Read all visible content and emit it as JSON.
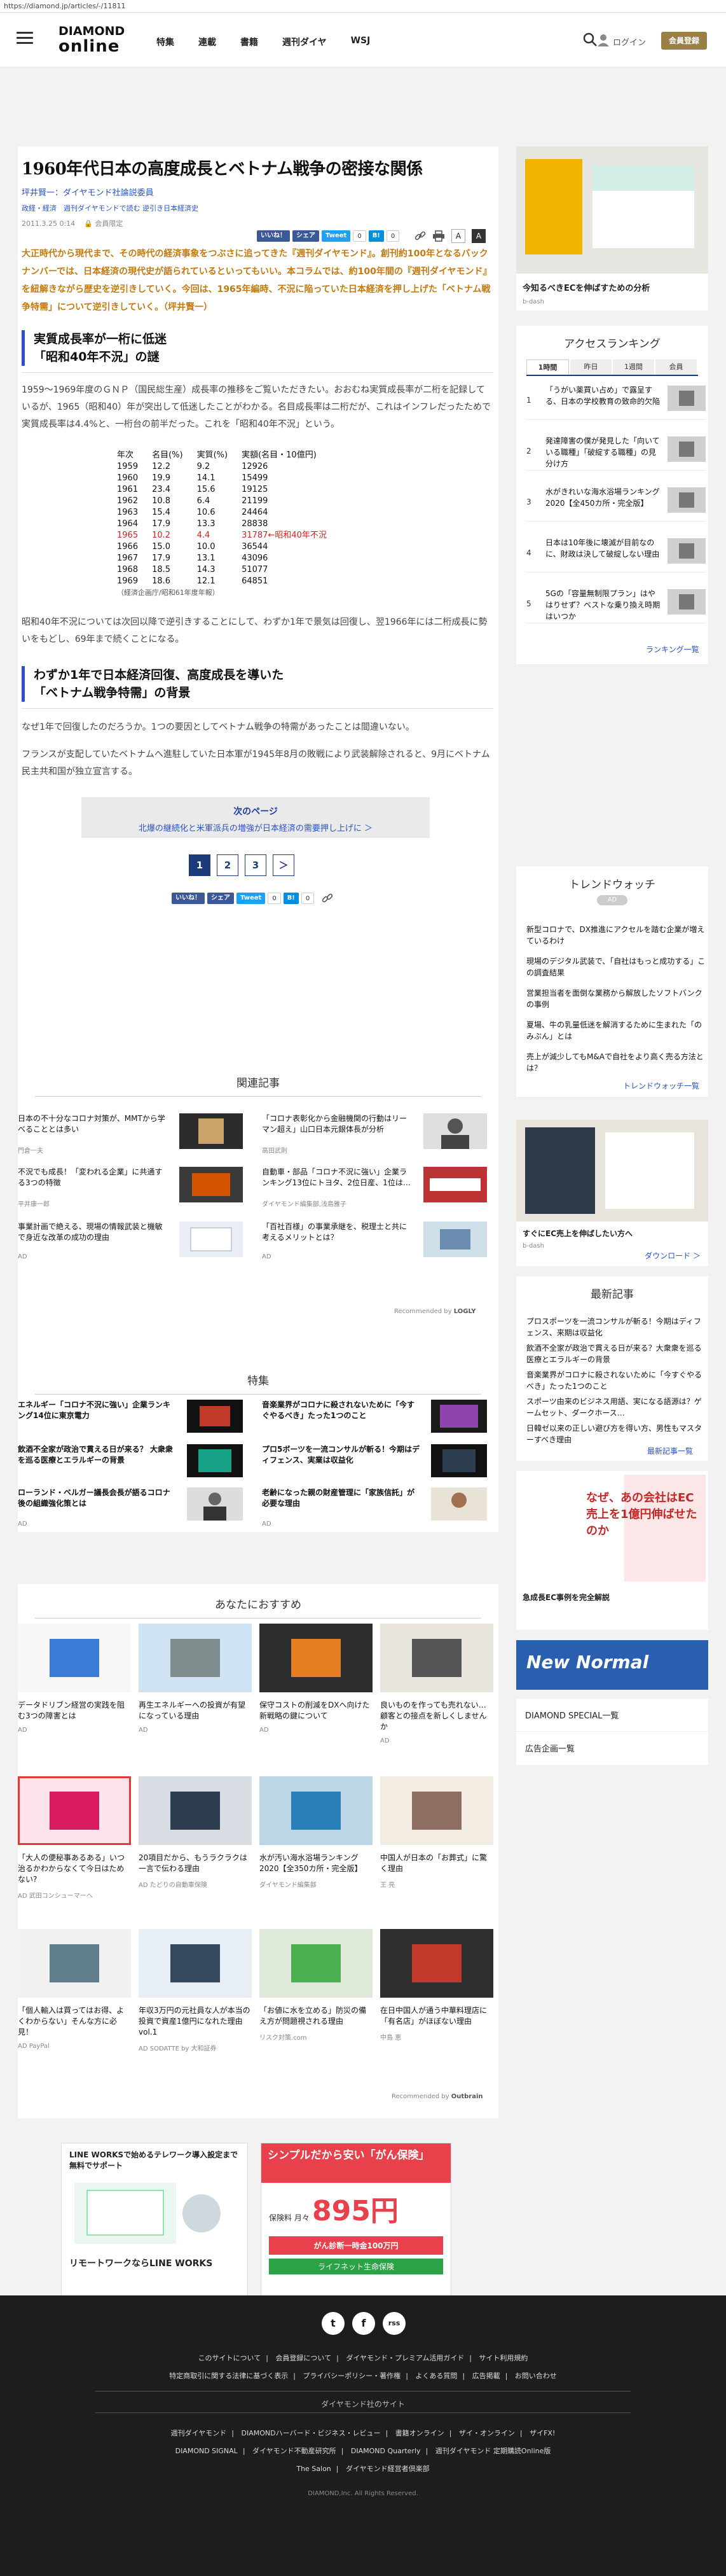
{
  "browser": {
    "url": "https://diamond.jp/articles/-/11811"
  },
  "header": {
    "logo_line1": "DIAMOND",
    "logo_line2": "online",
    "nav": [
      "特集",
      "連載",
      "書籍",
      "週刊ダイヤ",
      "WSJ"
    ],
    "login": "ログイン",
    "member": "会員登録"
  },
  "article": {
    "title": "1960年代日本の高度成長とベトナム戦争の密接な関係",
    "author": "坪井賢一：ダイヤモンド社論説委員",
    "categories": "政経・経済　週刊ダイヤモンドで読む 逆引き日本経済史",
    "date": "2011.3.25 0:14",
    "members_only": "会員限定",
    "share": {
      "fb": "いいね！",
      "fb_share": "シェア",
      "tw": "Tweet",
      "count1": "0",
      "hb": "B!",
      "count2": "0"
    },
    "font_small": "A",
    "font_large": "A",
    "lead": "大正時代から現代まで、その時代の経済事象をつぶさに追ってきた『週刊ダイヤモンド』。創刊約100年となるバックナンバーでは、日本経済の現代史が語られているといってもいい。本コラムでは、約100年間の『週刊ダイヤモンド』を紐解きながら歴史を逆引きしていく。今回は、1965年編時、不況に陥っていた日本経済を押し上げた「ベトナム戦争特需」について逆引きしていく。（坪井賢一）",
    "h2_1_line1": "実質成長率が一桁に低迷",
    "h2_1_line2": "「昭和40年不況」の謎",
    "p1": "1959～1969年度のＧＮＰ（国民総生産）成長率の推移をご覧いただきたい。おおむね実質成長率が二桁を記録しているが、1965（昭和40）年が突出して低迷したことがわかる。名目成長率は二桁だが、これはインフレだったためで実質成長率は4.4%と、一桁台の前半だった。これを「昭和40年不況」という。",
    "gdp_table": {
      "headers": [
        "年次",
        "名目(%)",
        "実質(%)",
        "実額(名目・10億円)"
      ],
      "rows": [
        [
          "1959",
          "12.2",
          "9.2",
          "12926",
          ""
        ],
        [
          "1960",
          "19.9",
          "14.1",
          "15499",
          ""
        ],
        [
          "1961",
          "23.4",
          "15.6",
          "19125",
          ""
        ],
        [
          "1962",
          "10.8",
          "6.4",
          "21199",
          ""
        ],
        [
          "1963",
          "15.4",
          "10.6",
          "24464",
          ""
        ],
        [
          "1964",
          "17.9",
          "13.3",
          "28838",
          ""
        ],
        [
          "1965",
          "10.2",
          "4.4",
          "31787",
          "←昭和40年不況"
        ],
        [
          "1966",
          "15.0",
          "10.0",
          "36544",
          ""
        ],
        [
          "1967",
          "17.9",
          "13.1",
          "43096",
          ""
        ],
        [
          "1968",
          "18.5",
          "14.3",
          "51077",
          ""
        ],
        [
          "1969",
          "18.6",
          "12.1",
          "64851",
          ""
        ]
      ],
      "note": "（経済企画庁/昭和61年度年報）"
    },
    "p2": "昭和40年不況については次回以降で逆引きすることにして、わずか1年で景気は回復し、翌1966年には二桁成長に勢いをもどし、69年まで続くことになる。",
    "h2_2_line1": "わずか1年で日本経済回復、高度成長を導いた",
    "h2_2_line2": "「ベトナム戦争特需」の背景",
    "p3": "なぜ1年で回復したのだろうか。1つの要因としてベトナム戦争の特需があったことは間違いない。",
    "p4": "フランスが支配していたベトナムへ進駐していた日本軍が1945年8月の敗戦により武装解除されると、9月にベトナム民主共和国が独立宣言する。",
    "next_label": "次のページ",
    "next_title": "北爆の継続化と米軍派兵の増強が日本経済の需要押し上げに ＞",
    "pages": [
      "1",
      "2",
      "3",
      "＞"
    ]
  },
  "related": {
    "title": "関連記事",
    "items": [
      {
        "text": "日本の不十分なコロナ対策が、MMTから学べることとは多い",
        "source": "門倉一夫"
      },
      {
        "text": "「コロナ表彰化から金融機関の行動はリーマン超え」山口日本元銀体長が分析",
        "source": "高田武則"
      },
      {
        "text": "不況でも成長！「変われる企業」に共通する3つの特徴",
        "source": "平井康一郎"
      },
      {
        "text": "自動車・部品「コロナ不況に強い」企業ランキング13位にトヨタ、2位日産、1位は…",
        "source": "ダイヤモンド編集部,浅島雅子"
      },
      {
        "text": "事業計画で絶える、現場の情報武装と機敏で身近な改革の成功の理由",
        "source": "AD"
      },
      {
        "text": "「百社百様」の事業承継を、税理士と共に考えるメリットとは？",
        "source": "AD"
      }
    ],
    "recommended": "Recommended by",
    "recommended_brand": "LOGLY"
  },
  "feature": {
    "title": "特集",
    "items": [
      {
        "text": "エネルギー「コロナ不況に強い」企業ランキング14位に東京電力",
        "source": ""
      },
      {
        "text": "音楽業界がコロナに殺されないために「今すぐやるべき」たった1つのこと",
        "source": ""
      },
      {
        "text": "飲酒不全家が政治で貫える日が来る？ 大衆衆を巡る医療とエラルギーの背景",
        "source": ""
      },
      {
        "text": "プロ5ボーツを一流コンサルが斬る！今期はディフェンス、実業は収益化",
        "source": ""
      },
      {
        "text": "ローランド・ベルガー議長会長が語るコロナ後の組織強化策とは",
        "source": "AD"
      },
      {
        "text": "老齢になった親の財産管理に「家族信託」が必要な理由",
        "source": "AD"
      }
    ]
  },
  "recommend": {
    "title": "あなたにおすすめ",
    "items": [
      {
        "text": "データドリブン経営の実践を阻む3つの障害とは",
        "source": "AD"
      },
      {
        "text": "再生エネルギーへの投資が有望になっている理由",
        "source": "AD"
      },
      {
        "text": "保守コストの削減をDXへ向けた新戦略の鍵について",
        "source": "AD"
      },
      {
        "text": "良いものを作っても売れない…顧客との接点を新しくしませんか",
        "source": "AD"
      },
      {
        "text": "「大人の便秘事あるある」いつ治るかわからなくて今日はためない?",
        "source": "AD 武田コンシューマーヘ"
      },
      {
        "text": "20項目だから、もうラクラクは一言で伝わる理由",
        "source": "AD たどりの自動車保険"
      },
      {
        "text": "水が汚い海水浴場ランキング2020【全350カ所・完全版】",
        "source": "ダイヤモンド編集部"
      },
      {
        "text": "中国人が日本の「お葬式」に驚く理由",
        "source": "王 亮"
      },
      {
        "text": "「個人輸入は買ってはお得、よくわからない」そんな方に必見！",
        "source": "AD PayPal"
      },
      {
        "text": "年収3万円の元社員な人が本当の投資で資産1億円になれた理由 vol.1",
        "source": "AD SODATTE by 大和証券"
      },
      {
        "text": "「お値に水を立める」防災の備え方が問題視される理由",
        "source": "リスク対策.com"
      },
      {
        "text": "在日中国人が通う中華料理店に「有名店」がほぼない理由",
        "source": "中島 恵"
      }
    ],
    "recommended": "Recommended by",
    "recommended_brand": "Outbrain"
  },
  "ads": {
    "lineworks_title": "LINE WORKSで始めるテレワーク導入設定まで無料でサポート",
    "lineworks_sub": "リモートワークならLINE WORKS",
    "insurance_title": "シンプルだから安い「がん保険」",
    "insurance_price": "895円",
    "insurance_per": "保険料 月々",
    "insurance_cta": "がん診断一時金100万円",
    "insurance_brand": "ライフネット生命保険"
  },
  "sidebar": {
    "ad1_caption": "今知るべきECを伸ばすための分析",
    "ad1_brand": "b-dash",
    "ranking_title": "アクセスランキング",
    "ranking_tabs": [
      "1時間",
      "昨日",
      "1週間",
      "会員"
    ],
    "ranking": [
      {
        "n": "1",
        "t": "「うがい薬買い占め」で露呈する、日本の学校教育の致命的欠陥"
      },
      {
        "n": "2",
        "t": "発達障害の僕が発見した「向いている職種」「破綻する職種」の見分け方"
      },
      {
        "n": "3",
        "t": "水がきれいな海水浴場ランキング2020【全450カ所・完全版】"
      },
      {
        "n": "4",
        "t": "日本は10年後に壊滅が目前なのに、財政は決して破綻しない理由"
      },
      {
        "n": "5",
        "t": "5Gの「容量無制限プラン」はやはりせず？ベストな乗り換え時期はいつか"
      }
    ],
    "ranking_more": "ランキング一覧",
    "trend_title": "トレンドウォッチ",
    "trend_badge": "AD",
    "trend": [
      "新型コロナで、DX推進にアクセルを踏む企業が増えているわけ",
      "現場のデジタル武装で、「自社はもっと成功する」この調査結果",
      "営業担当者を面倒な業務から解放したソフトバンクの事例",
      "夏場、牛の乳量低迷を解消するために生まれた「のみぶん」とは",
      "売上が減少してもM&Aで自社をより高く売る方法とは？"
    ],
    "trend_more": "トレンドウォッチ一覧",
    "ad2_caption": "すぐにEC売上を伸ばしたい方へ",
    "ad2_brand": "b-dash",
    "ad2_download": "ダウンロード ＞",
    "news_title": "最新記事",
    "news": [
      "プロスポーツを一流コンサルが斬る！今期はディフェンス、来期は収益化",
      "飲酒不全家が政治で貫える日が来る？大衆衆を巡る医療とエラルギーの背景",
      "音楽業界がコロナに殺されないために「今すぐやるべき」たった1つのこと",
      "スポーツ由来のビジネス用語、実になる語源は？ゲームセット、ダークホース…",
      "日韓ゼ以来の正しい避び方を得い方、男性もマスターすべき理由"
    ],
    "news_more": "最新記事一覧",
    "ad3_title": "なぜ、あの会社はEC売上を1億円伸ばせたのか",
    "ad3_sub": "急成長EC事例を完全解説",
    "ad4_title": "New Normal",
    "special": "DIAMOND SPECIAL一覧",
    "adlist": "広告企画一覧"
  },
  "footer": {
    "icons": [
      "t",
      "f",
      "rss"
    ],
    "links1": [
      "このサイトについて",
      "会員登録について",
      "ダイヤモンド・プレミアム活用ガイド",
      "サイト利用規約"
    ],
    "links2": [
      "特定商取引に関する法律に基づく表示",
      "プライバシーポリシー・著作権",
      "よくある質問",
      "広告掲載",
      "お問い合わせ"
    ],
    "group_title": "ダイヤモンド社のサイト",
    "brands1": [
      "週刊ダイヤモンド",
      "DIAMONDハーバード・ビジネス・レビュー",
      "書籍オンライン",
      "ザイ・オンライン",
      "ザイFX!"
    ],
    "brands2": [
      "DIAMOND SIGNAL",
      "ダイヤモンド不動産研究所",
      "DIAMOND Quarterly",
      "週刊ダイヤモンド 定期購読Online版"
    ],
    "brands3": [
      "The Salon",
      "ダイヤモンド経営者倶楽部"
    ],
    "copyright": "DIAMOND,Inc. All Rights Reserved."
  }
}
